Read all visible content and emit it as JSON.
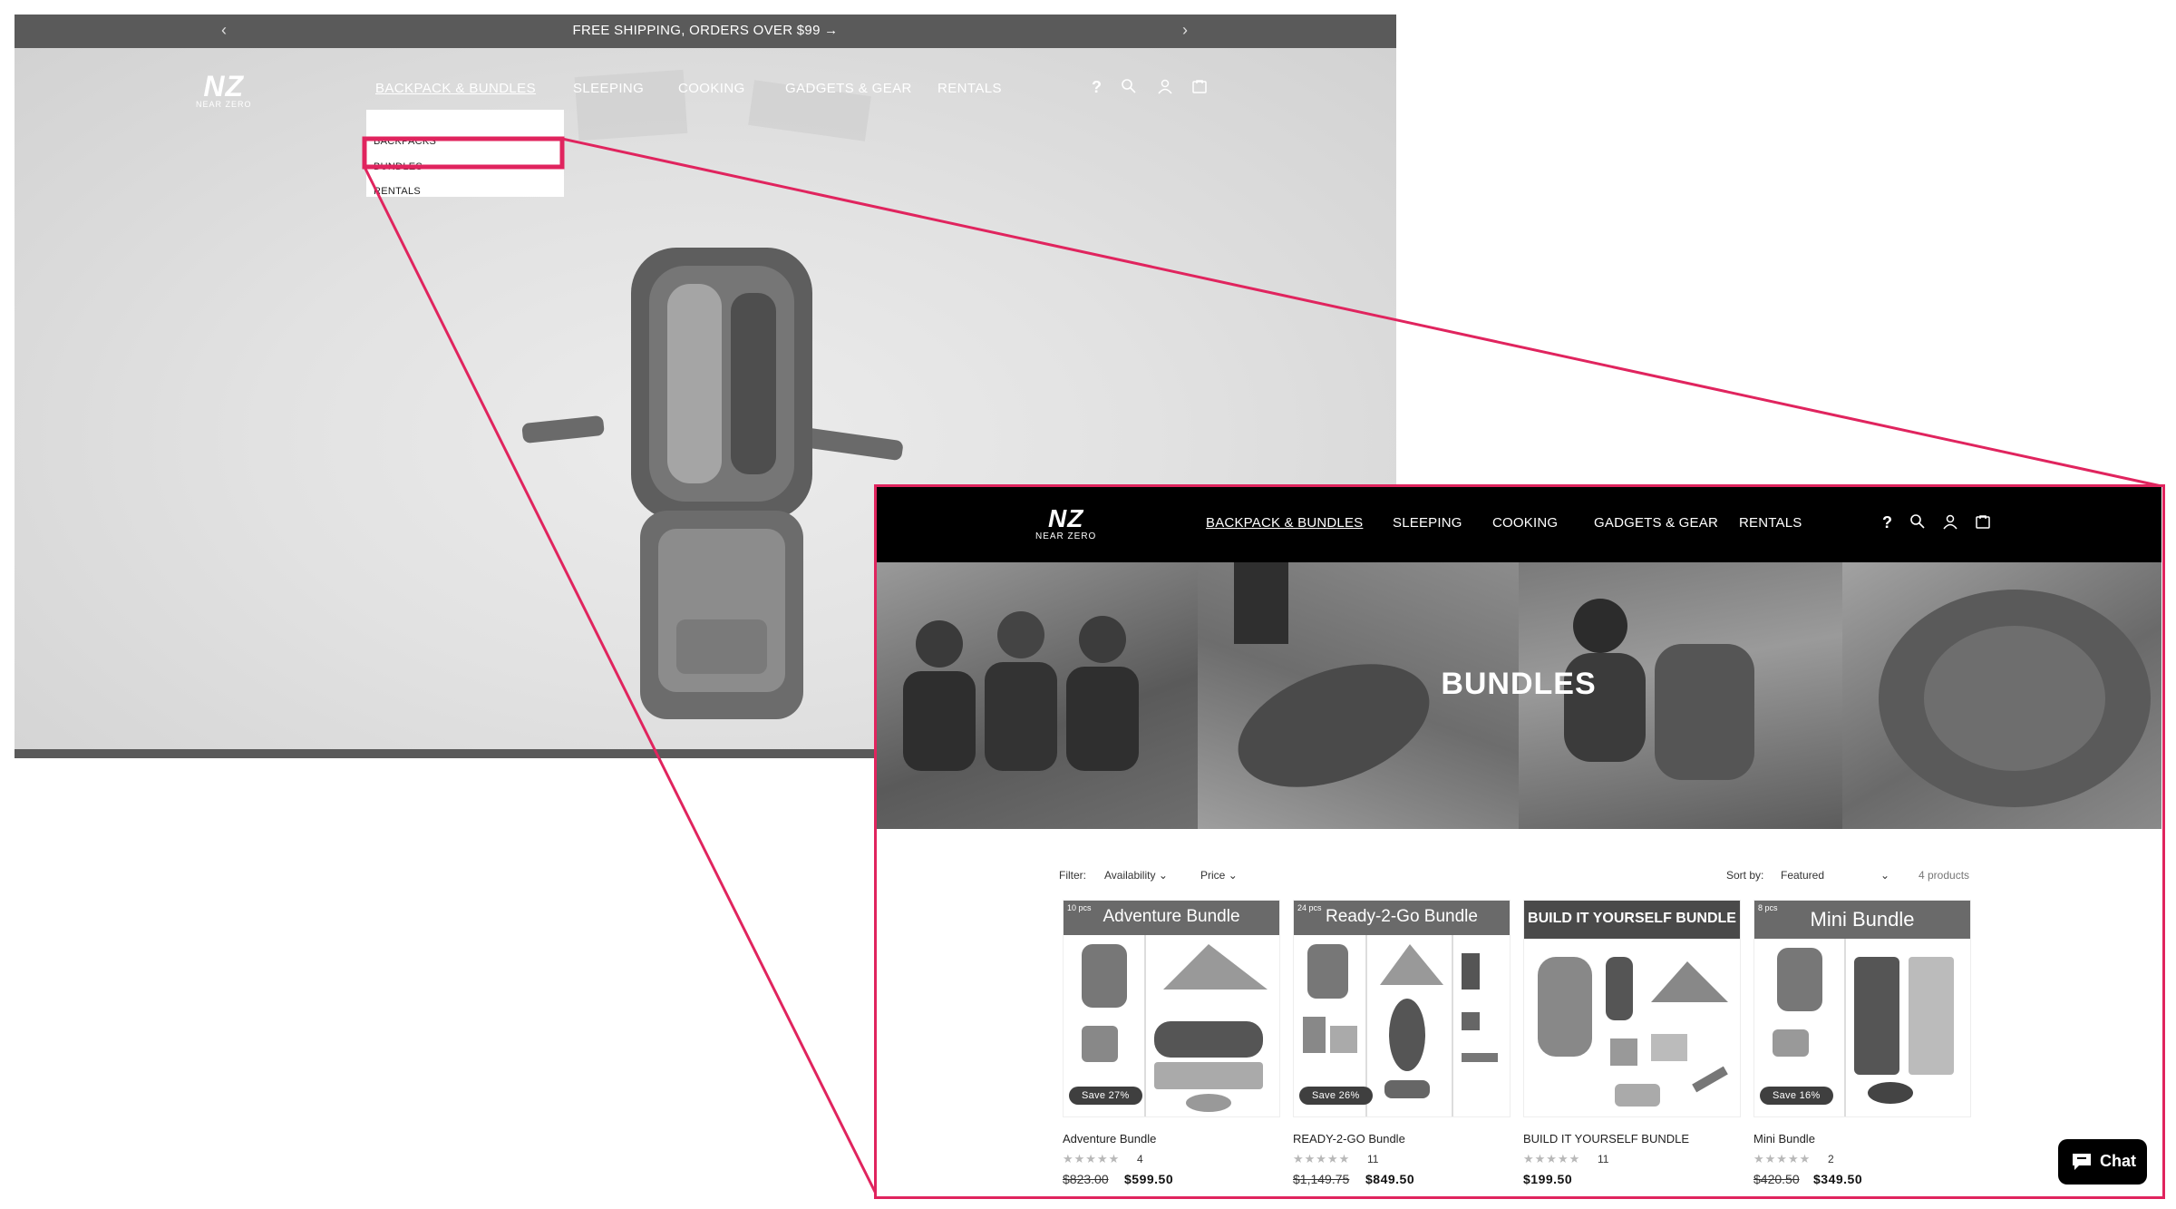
{
  "left_screen": {
    "announcement": "FREE SHIPPING, ORDERS OVER $99 →",
    "prev_arrow": "‹",
    "next_arrow": "›",
    "logo": {
      "mark": "NZ",
      "tagline": "NEAR ZERO"
    },
    "nav": [
      "BACKPACK & BUNDLES",
      "SLEEPING",
      "COOKING",
      "GADGETS & GEAR",
      "RENTALS"
    ],
    "icons": [
      "help-icon",
      "search-icon",
      "account-icon",
      "cart-icon"
    ],
    "help_glyph": "?",
    "dropdown": [
      "BACKPACKS",
      "BUNDLES",
      "RENTALS"
    ],
    "highlighted_item": "BUNDLES"
  },
  "inset_screen": {
    "logo": {
      "mark": "NZ",
      "tagline": "NEAR ZERO"
    },
    "nav": [
      "BACKPACK & BUNDLES",
      "SLEEPING",
      "COOKING",
      "GADGETS & GEAR",
      "RENTALS"
    ],
    "help_glyph": "?",
    "banner_title": "BUNDLES",
    "filter": {
      "label": "Filter:",
      "availability": "Availability",
      "price": "Price",
      "sort_label": "Sort by:",
      "sort_value": "Featured",
      "count": "4 products"
    },
    "products": [
      {
        "header": "Adventure Bundle",
        "pcs": "10 pcs",
        "save": "Save 27%",
        "name": "Adventure Bundle",
        "reviews": "4",
        "old_price": "$823.00",
        "price": "$599.50"
      },
      {
        "header": "Ready-2-Go Bundle",
        "pcs": "24 pcs",
        "save": "Save 26%",
        "name": "READY-2-GO Bundle",
        "reviews": "11",
        "old_price": "$1,149.75",
        "price": "$849.50"
      },
      {
        "header": "BUILD IT YOURSELF BUNDLE",
        "pcs": "",
        "save": "",
        "name": "BUILD IT YOURSELF BUNDLE",
        "reviews": "11",
        "old_price": "",
        "price": "$199.50"
      },
      {
        "header": "Mini Bundle",
        "pcs": "8 pcs",
        "save": "Save 16%",
        "name": "Mini Bundle",
        "reviews": "2",
        "old_price": "$420.50",
        "price": "$349.50"
      }
    ],
    "stars": "★★★★★",
    "chat_label": "Chat"
  },
  "colors": {
    "highlight": "#e0245e",
    "header": "#000000",
    "announce": "#5a5a5a"
  }
}
